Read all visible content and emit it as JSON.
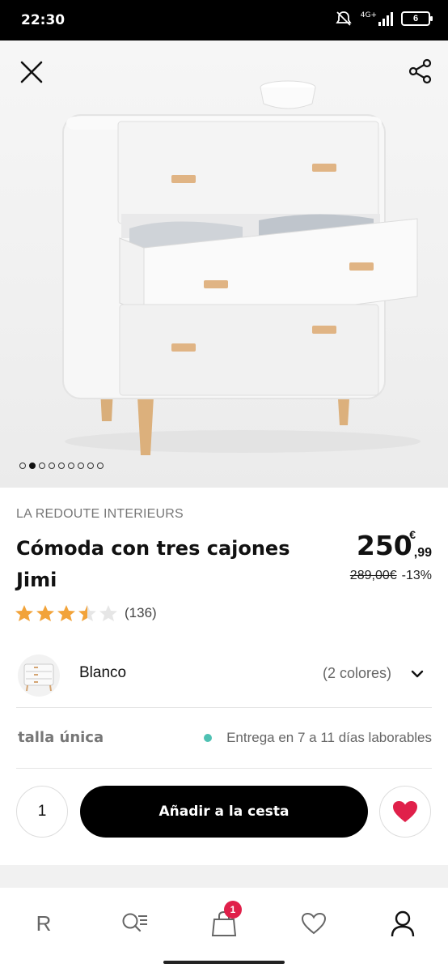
{
  "status_bar": {
    "time": "22:30",
    "network": "4G+",
    "battery": "6"
  },
  "hero": {
    "image_count": 9,
    "active_index": 1
  },
  "product": {
    "brand": "LA REDOUTE INTERIEURS",
    "title": "Cómoda con tres cajones Jimi",
    "price_integer": "250",
    "price_decimal": ",99",
    "currency": "€",
    "old_price": "289,00€",
    "discount": "-13%",
    "rating": 3.5,
    "review_count": "(136)"
  },
  "color": {
    "name": "Blanco",
    "options": "(2 colores)"
  },
  "size": {
    "label": "talla única"
  },
  "delivery": {
    "text": "Entrega en 7 a 11 días laborables",
    "dot_color": "#4fc1b3"
  },
  "cart": {
    "quantity": "1",
    "add_label": "Añadir a la cesta",
    "fav_color": "#e0204a"
  },
  "bottom_nav": {
    "home": "R",
    "cart_badge": "1"
  }
}
